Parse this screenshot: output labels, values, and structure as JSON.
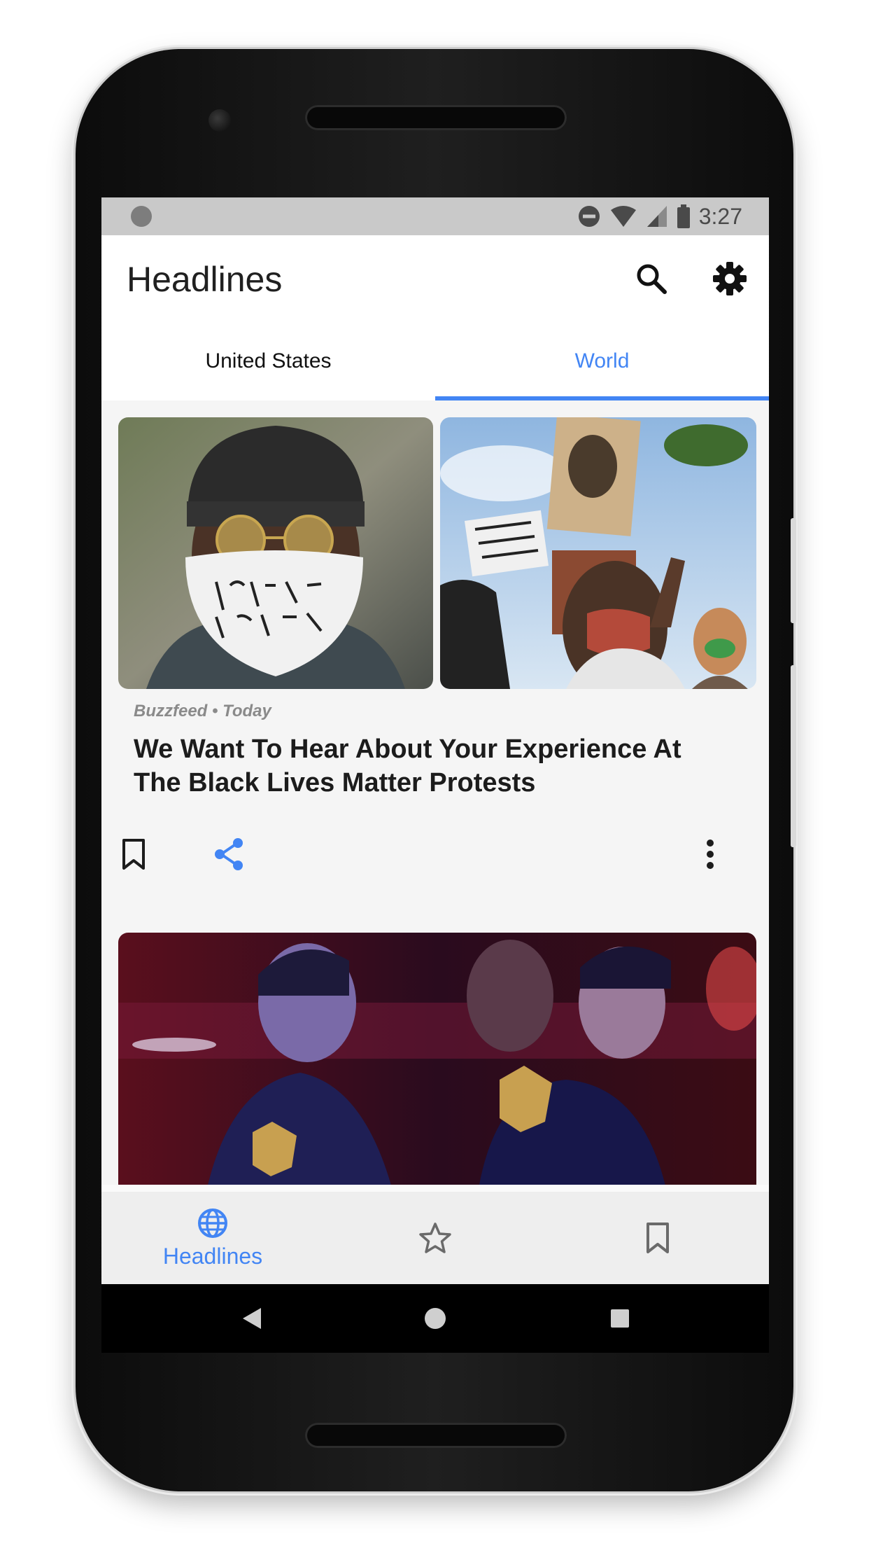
{
  "status_bar": {
    "time": "3:27",
    "icons": [
      "do-not-disturb-icon",
      "wifi-icon",
      "cellular-signal-icon",
      "battery-icon"
    ]
  },
  "app_bar": {
    "title": "Headlines",
    "actions": [
      "search-icon",
      "settings-gear-icon"
    ]
  },
  "tabs": [
    {
      "label": "United States",
      "active": false
    },
    {
      "label": "World",
      "active": true
    }
  ],
  "articles": [
    {
      "source_line": "Buzzfeed • Today",
      "title": "We Want To Hear About Your Experience At The Black Lives Matter Protests",
      "images": [
        "protester-mask-photo",
        "protest-crowd-photo"
      ],
      "actions": [
        "bookmark-icon",
        "share-icon",
        "more-options-icon"
      ]
    },
    {
      "images": [
        "police-officers-photo"
      ]
    }
  ],
  "bottom_nav": {
    "items": [
      {
        "label": "Headlines",
        "icon": "globe-icon",
        "active": true
      },
      {
        "label": "",
        "icon": "star-icon",
        "active": false
      },
      {
        "label": "",
        "icon": "bookmark-icon",
        "active": false
      }
    ]
  },
  "colors": {
    "accent": "#4285f4",
    "text_primary": "#1c1c1c",
    "text_secondary": "#8a8a8a",
    "status_bar": "#c9c9c9",
    "bottom_nav_bg": "#eeeeee"
  }
}
